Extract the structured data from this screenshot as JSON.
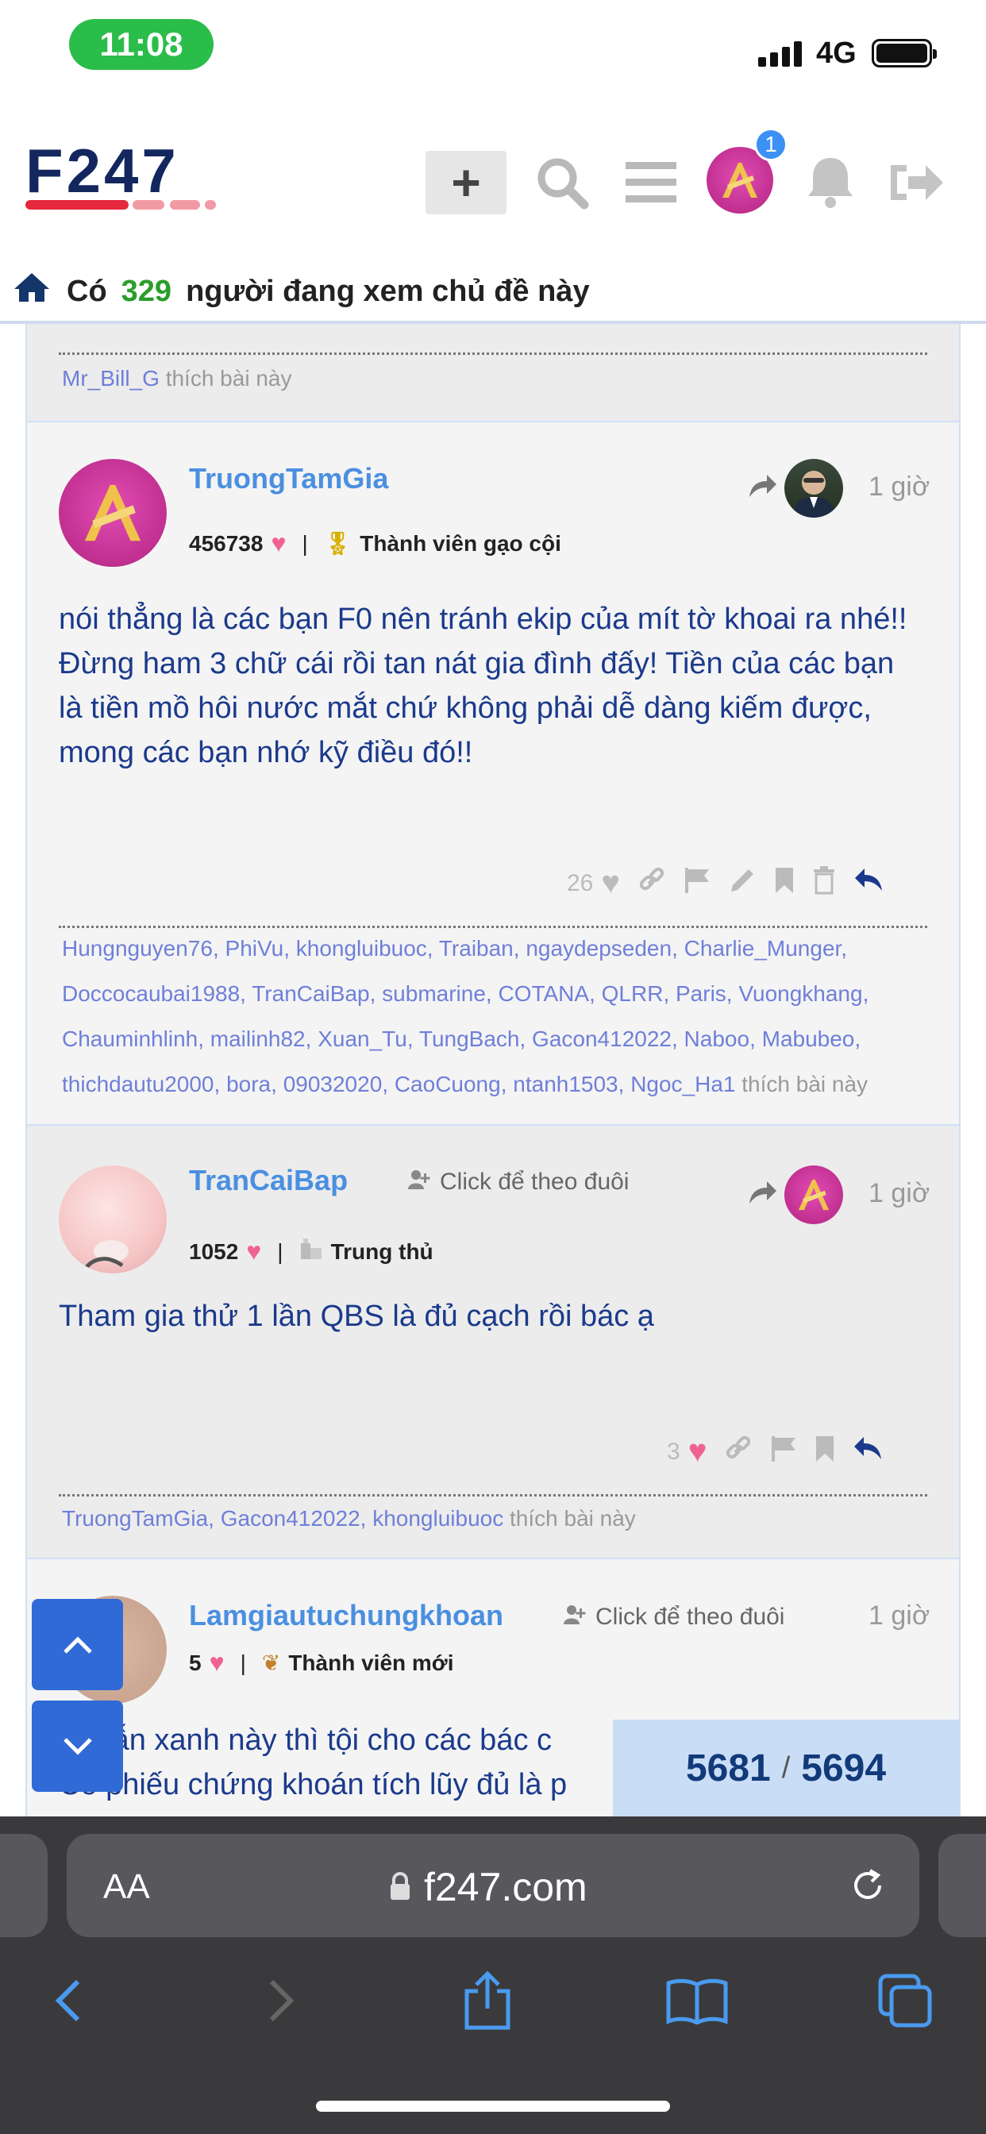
{
  "status": {
    "time": "11:08",
    "network": "4G"
  },
  "header": {
    "logo_text": "F247",
    "notification_count": "1"
  },
  "viewers": {
    "prefix": "Có",
    "count": "329",
    "suffix": "người đang xem chủ đề này"
  },
  "prev_post": {
    "liker": "Mr_Bill_G",
    "likes_suffix": "thích bài này"
  },
  "posts": [
    {
      "username": "TruongTamGia",
      "score": "456738",
      "rank": "Thành viên gạo cội",
      "time": "1 giờ",
      "text": "nói thẳng là các bạn F0 nên tránh ekip của mít tờ khoai ra nhé!! Đừng ham 3 chữ cái rồi tan nát gia đình đấy! Tiền của các bạn là tiền mồ hôi nước mắt chứ không phải dễ dàng kiếm được, mong các bạn nhớ kỹ điều đó!!",
      "like_count": "26",
      "likers": [
        "Hungnguyen76",
        "PhiVu",
        "khongluibuoc",
        "Traiban",
        "ngaydepseden",
        "Charlie_Munger",
        "Doccocaubai1988",
        "TranCaiBap",
        "submarine",
        "COTANA",
        "QLRR",
        "Paris",
        "Vuongkhang",
        "Chauminhlinh",
        "mailinh82",
        "Xuan_Tu",
        "TungBach",
        "Gacon412022",
        "Naboo",
        "Mabubeo",
        "thichdautu2000",
        "bora",
        "09032020",
        "CaoCuong",
        "ntanh1503",
        "Ngoc_Ha1"
      ],
      "likes_suffix": "thích bài này"
    },
    {
      "username": "TranCaiBap",
      "follow_label": "Click để theo đuôi",
      "score": "1052",
      "rank": "Trung thủ",
      "time": "1 giờ",
      "text": "Tham gia thử 1 lần QBS là đủ cạch rồi bác ạ",
      "like_count": "3",
      "likers": [
        "TruongTamGia",
        "Gacon412022",
        "khongluibuoc"
      ],
      "likes_suffix": "thích bài này"
    },
    {
      "username": "Lamgiautuchungkhoan",
      "follow_label": "Click để theo đuôi",
      "score": "5",
      "rank": "Thành viên mới",
      "time": "1 giờ",
      "text_line1": "… vẫn xanh này thì tội cho các bác c",
      "text_line2": "Cổ phiếu chứng khoán tích lũy đủ là p"
    }
  ],
  "counter": {
    "current": "5681",
    "separator": "/",
    "total": "5694"
  },
  "browser": {
    "aa": "AA",
    "url": "f247.com"
  },
  "colors": {
    "accent_blue": "#4a8fe0",
    "text_blue": "#1b3a8c",
    "green": "#2a9d2a",
    "heart": "#f06292",
    "fab": "#2f6ad6"
  }
}
